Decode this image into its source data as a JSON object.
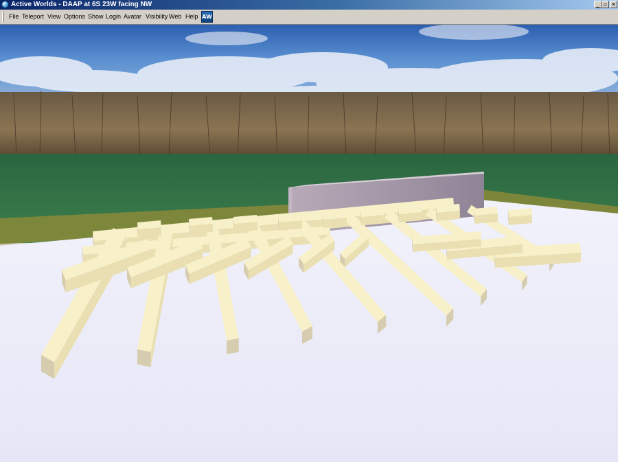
{
  "window": {
    "title": "Active Worlds - DAAP at 6S 23W facing NW",
    "icon": "globe-icon"
  },
  "caption_buttons": {
    "minimize": "_",
    "maximize": "▫",
    "close": "✕"
  },
  "menu": {
    "items": [
      "File",
      "Teleport",
      "View",
      "Options",
      "Show",
      "Login",
      "Avatar",
      "Visibility",
      "Web",
      "Help"
    ],
    "logo": "AW"
  },
  "colors": {
    "titlebar_start": "#0a246a",
    "titlebar_end": "#a6caf0",
    "sky": "#3f78c4",
    "grass": "#2f6e45",
    "floor": "#ececfa",
    "beam": "#f4ecc0",
    "wall": "#a89aa8"
  }
}
